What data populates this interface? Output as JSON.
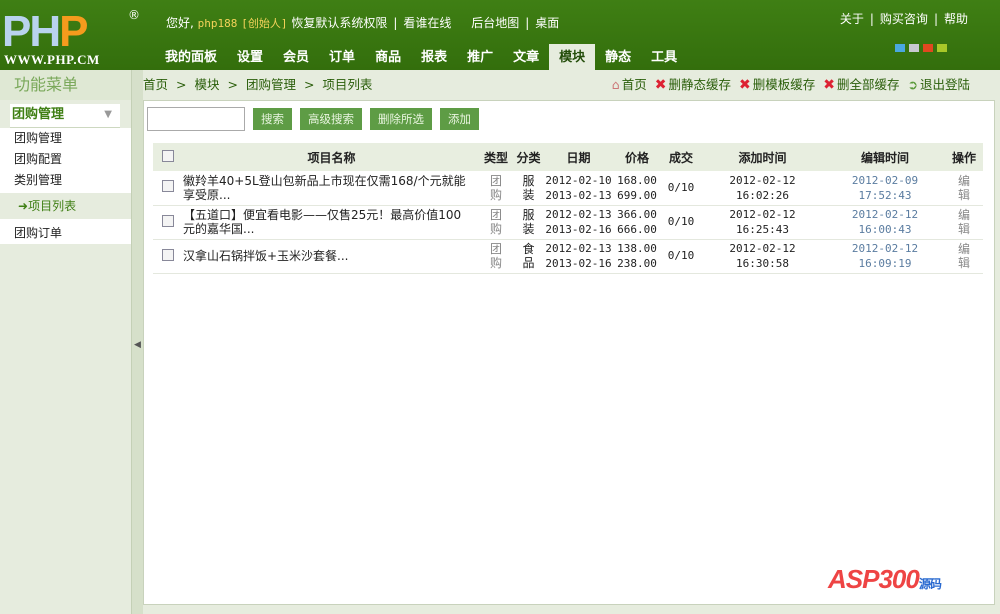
{
  "logo": {
    "text1": "PH",
    "text2": "P",
    "reg": "®",
    "url": "WWW.PHP.CM"
  },
  "top": {
    "greeting": "您好,",
    "user": "php188",
    "role": "[创始人]",
    "restore": "恢复默认系统权限",
    "online": "看谁在线",
    "sitemap": "后台地图",
    "desktop": "桌面",
    "links": [
      "关于",
      "购买咨询",
      "帮助"
    ]
  },
  "nav": [
    "我的面板",
    "设置",
    "会员",
    "订单",
    "商品",
    "报表",
    "推广",
    "文章",
    "模块",
    "静态",
    "工具"
  ],
  "active_nav": "模块",
  "skins": [
    "#4aa8e0",
    "#c8c8d0",
    "#e04820",
    "#a8c828"
  ],
  "sidebar": {
    "title": "功能菜单",
    "group": "团购管理",
    "items": [
      "团购管理",
      "团购配置",
      "类别管理",
      "项目列表",
      "团购订单"
    ],
    "current": "项目列表"
  },
  "breadcrumb": [
    "首页",
    ">",
    "模块",
    ">",
    "团购管理",
    ">",
    "项目列表"
  ],
  "actions": [
    "首页",
    "删静态缓存",
    "删模板缓存",
    "删全部缓存",
    "退出登陆"
  ],
  "toolbar": {
    "search_value": "",
    "buttons": [
      "搜索",
      "高级搜索",
      "删除所选",
      "添加"
    ]
  },
  "table": {
    "headers": [
      "项目名称",
      "类型",
      "分类",
      "日期",
      "价格",
      "成交",
      "添加时间",
      "编辑时间",
      "操作"
    ],
    "rows": [
      {
        "name": "徽羚羊40+5L登山包新品上市现在仅需168/个元就能享受原...",
        "type": "团购",
        "cat": "服装",
        "d1": "2012-02-10",
        "d2": "2013-02-13",
        "p1": "168.00",
        "p2": "699.00",
        "deal": "0/10",
        "add1": "2012-02-12",
        "add2": "16:02:26",
        "edit1": "2012-02-09",
        "edit2": "17:52:43",
        "op": "编辑"
      },
      {
        "name": "【五道口】便宜看电影——仅售25元！最高价值100元的嘉华国...",
        "type": "团购",
        "cat": "服装",
        "d1": "2012-02-13",
        "d2": "2013-02-16",
        "p1": "366.00",
        "p2": "666.00",
        "deal": "0/10",
        "add1": "2012-02-12",
        "add2": "16:25:43",
        "edit1": "2012-02-12",
        "edit2": "16:00:43",
        "op": "编辑"
      },
      {
        "name": "汉拿山石锅拌饭+玉米沙套餐...",
        "type": "团购",
        "cat": "食品",
        "d1": "2012-02-13",
        "d2": "2013-02-16",
        "p1": "138.00",
        "p2": "238.00",
        "deal": "0/10",
        "add1": "2012-02-12",
        "add2": "16:30:58",
        "edit1": "2012-02-12",
        "edit2": "16:09:19",
        "op": "编辑"
      }
    ]
  },
  "watermark": {
    "text": "ASP300",
    "sub": "源码 .com"
  }
}
